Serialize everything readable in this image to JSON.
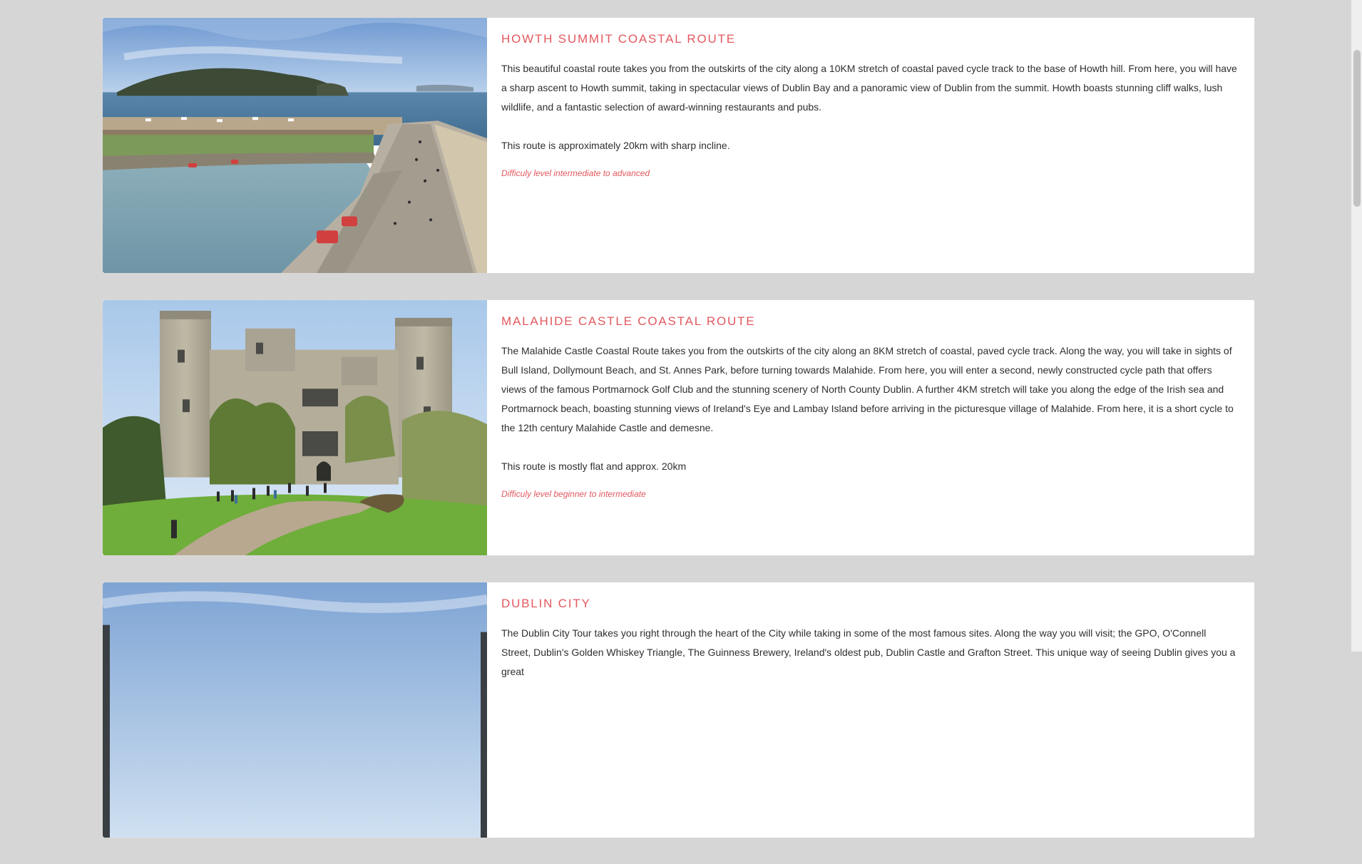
{
  "colors": {
    "page_background": "#d6d6d6",
    "card_background": "#ffffff",
    "title_accent": "#e2585f",
    "body_text": "#2f2f2f"
  },
  "routes": [
    {
      "title": "HOWTH SUMMIT COASTAL ROUTE",
      "description": "This beautiful coastal route takes you from the outskirts of the city along a 10KM stretch of coastal paved cycle track to the base of Howth hill. From here, you will have a sharp ascent to Howth summit, taking in spectacular views of Dublin Bay and a panoramic view of Dublin from the summit. Howth boasts stunning cliff walks, lush wildlife, and a fantastic selection of award-winning restaurants and pubs.",
      "distance": "This route is approximately 20km with sharp incline.",
      "difficulty": "Difficuly level intermediate to advanced",
      "image": "photo-howth-harbour"
    },
    {
      "title": "MALAHIDE CASTLE COASTAL ROUTE",
      "description": "The Malahide Castle Coastal Route takes you from the outskirts of the city along an 8KM stretch of coastal, paved cycle track. Along the way, you will take in sights of Bull Island, Dollymount Beach, and St. Annes Park, before turning towards Malahide. From here, you will enter a second, newly constructed cycle path that offers views of the famous Portmarnock Golf Club and the stunning scenery of North County Dublin. A further 4KM stretch will take you along the edge of the Irish sea and Portmarnock beach, boasting stunning views of Ireland's Eye and Lambay Island before arriving in the picturesque village of Malahide. From here, it is a short cycle to the 12th century Malahide Castle and demesne.",
      "distance": "This route is mostly flat and approx. 20km",
      "difficulty": "Difficuly level beginner to intermediate",
      "image": "photo-malahide-castle"
    },
    {
      "title": "DUBLIN CITY",
      "description": "The Dublin City Tour takes you right through the heart of the City while taking in some of the most famous sites. Along the way you will visit; the GPO, O'Connell Street, Dublin's Golden Whiskey Triangle, The Guinness Brewery, Ireland's oldest pub, Dublin Castle and Grafton Street. This unique way of seeing Dublin gives you a great",
      "distance": "",
      "difficulty": "",
      "image": "photo-dublin-city"
    }
  ]
}
